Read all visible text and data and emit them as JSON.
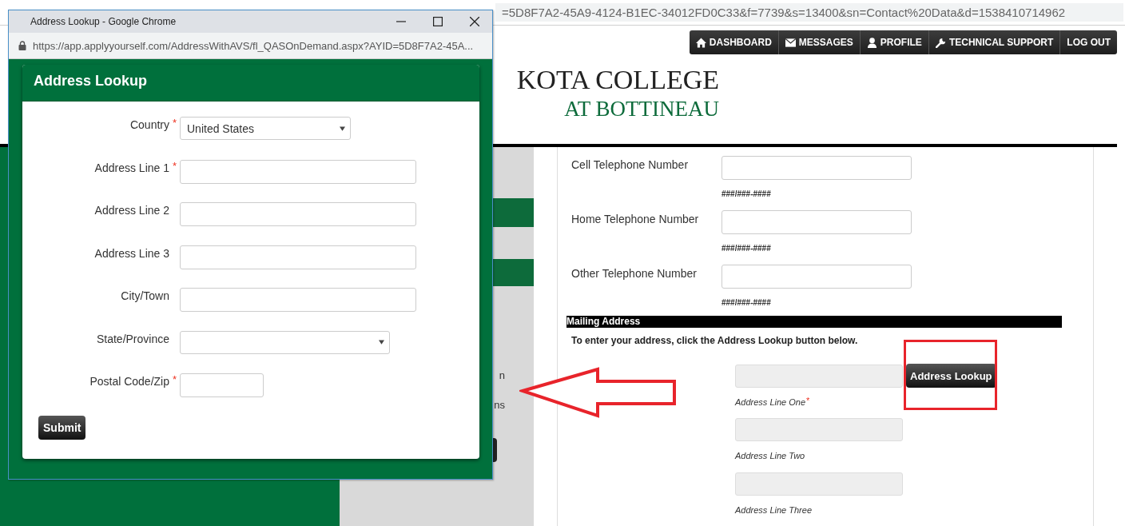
{
  "browser": {
    "url_visible": "=5D8F7A2-45A9-4124-B1EC-34012FD0C33&f=7739&s=13400&sn=Contact%20Data&d=1538410714962"
  },
  "top_nav": [
    {
      "label": "DASHBOARD"
    },
    {
      "label": "MESSAGES"
    },
    {
      "label": "PROFILE"
    },
    {
      "label": "TECHNICAL SUPPORT"
    },
    {
      "label": "LOG OUT"
    }
  ],
  "logo": {
    "line1": "KOTA COLLEGE",
    "line2": "AT BOTTINEAU"
  },
  "sidebar": {
    "fragments": [
      "n",
      "ns"
    ]
  },
  "contact_form": {
    "phones": [
      {
        "label": "Cell Telephone Number",
        "hint": "###/###-####"
      },
      {
        "label": "Home Telephone Number",
        "hint": "###/###-####"
      },
      {
        "label": "Other Telephone Number",
        "hint": "###/###-####"
      }
    ],
    "section_title": "Mailing Address",
    "instruction": "To enter your address, click the Address Lookup button below.",
    "lookup_button": "Address Lookup",
    "address_fields": [
      {
        "caption": "Address Line One",
        "required_mark": "*"
      },
      {
        "caption": "Address Line Two"
      },
      {
        "caption": "Address Line Three"
      }
    ]
  },
  "popup": {
    "window_title": "Address Lookup - Google Chrome",
    "url": "https://app.applyyourself.com/AddressWithAVS/fl_QASOnDemand.aspx?AYID=5D8F7A2-45A...",
    "heading": "Address Lookup",
    "fields": [
      {
        "label": "Country",
        "required_mark": "*",
        "kind": "select",
        "value": "United States"
      },
      {
        "label": "Address Line 1",
        "required_mark": "*",
        "kind": "text"
      },
      {
        "label": "Address Line 2",
        "kind": "text"
      },
      {
        "label": "Address Line 3",
        "kind": "text"
      },
      {
        "label": "City/Town",
        "kind": "text"
      },
      {
        "label": "State/Province",
        "kind": "select"
      },
      {
        "label": "Postal Code/Zip",
        "required_mark": "*",
        "kind": "postal"
      }
    ],
    "submit": "Submit"
  }
}
